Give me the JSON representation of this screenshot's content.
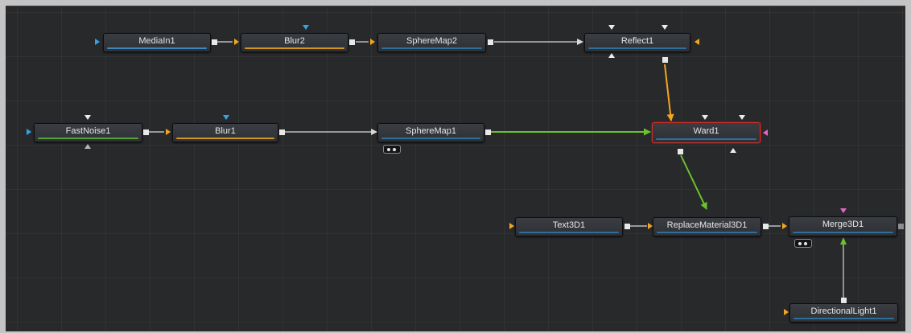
{
  "nodes": {
    "mediain1": {
      "label": "MediaIn1"
    },
    "blur2": {
      "label": "Blur2"
    },
    "spheremap2": {
      "label": "SphereMap2"
    },
    "reflect1": {
      "label": "Reflect1"
    },
    "fastnoise1": {
      "label": "FastNoise1"
    },
    "blur1": {
      "label": "Blur1"
    },
    "spheremap1": {
      "label": "SphereMap1"
    },
    "ward1": {
      "label": "Ward1"
    },
    "text3d1": {
      "label": "Text3D1"
    },
    "replacematerial3d1": {
      "label": "ReplaceMaterial3D1"
    },
    "merge3d1": {
      "label": "Merge3D1"
    },
    "directionallight1": {
      "label": "DirectionalLight1"
    }
  },
  "colors": {
    "background": "#28292b",
    "image_link": "#d9d9d9",
    "orange_input": "#f2a61f",
    "green_input": "#6cc12c",
    "selected_outline": "#d0302c",
    "blue_input": "#2ea6e8",
    "pink_input": "#e067c8"
  },
  "icons": [
    "view-toggle-icon",
    "input-arrow-icon",
    "output-port-icon"
  ]
}
